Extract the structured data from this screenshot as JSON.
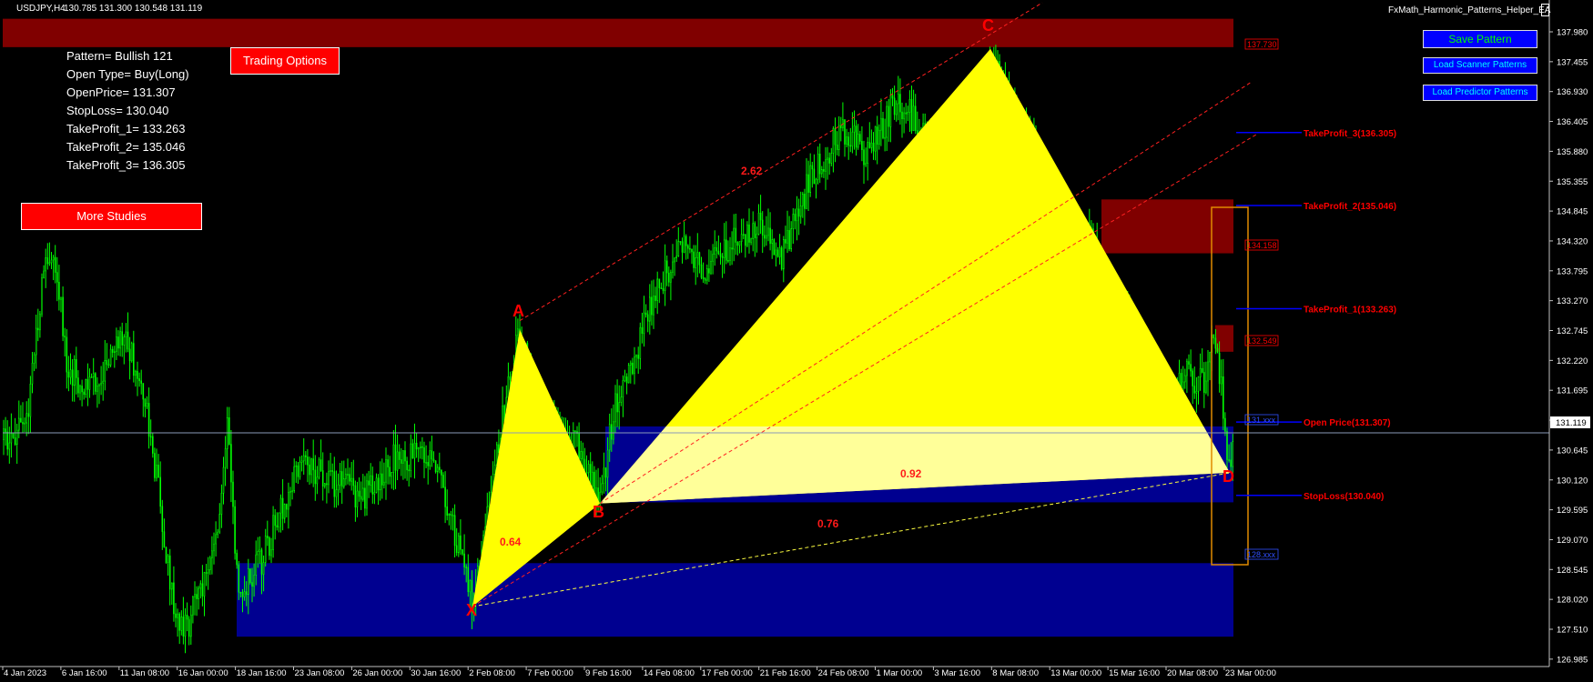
{
  "header": {
    "symbol": "USDJPY,H4",
    "ohlc": "130.785 131.300 130.548 131.119",
    "ea_name": "FxMath_Harmonic_Patterns_Helper_EA"
  },
  "info_panel": {
    "lines": [
      "Pattern= Bullish 121",
      "Open Type= Buy(Long)",
      "OpenPrice= 131.307",
      "StopLoss= 130.040",
      "TakeProfit_1= 133.263",
      "TakeProfit_2= 135.046",
      "TakeProfit_3= 136.305"
    ]
  },
  "buttons": {
    "trading_options": "Trading Options",
    "more_studies": "More Studies",
    "save_pattern": "Save Pattern",
    "load_scanner": "Load Scanner Patterns",
    "load_predictor": "Load Predictor Patterns"
  },
  "colors": {
    "background": "#000000",
    "candles": "#00ff00",
    "pattern_fill": "#ffff00",
    "pattern_fill_light": "#ffff99",
    "zone_red": "#800000",
    "zone_blue": "#000090",
    "label_red": "#ff0000",
    "level_line": "#0000ff",
    "ratio_text": "#ff1a1a",
    "bracket": "#e08a00"
  },
  "chart_data": {
    "type": "candlestick",
    "price_axis": {
      "range": [
        127.1,
        138.28
      ],
      "ticks": [
        "137.980",
        "137.455",
        "136.930",
        "136.405",
        "135.880",
        "135.355",
        "134.845",
        "134.320",
        "133.795",
        "133.270",
        "132.745",
        "132.220",
        "131.695",
        "131.170",
        "130.645",
        "130.120",
        "129.595",
        "129.070",
        "128.545",
        "128.020",
        "127.510",
        "126.985"
      ],
      "current_price": "131.119"
    },
    "time_axis": {
      "labels": [
        "4 Jan 2023",
        "6 Jan 16:00",
        "11 Jan 08:00",
        "16 Jan 00:00",
        "18 Jan 16:00",
        "23 Jan 08:00",
        "26 Jan 00:00",
        "30 Jan 16:00",
        "2 Feb 08:00",
        "7 Feb 00:00",
        "9 Feb 16:00",
        "14 Feb 08:00",
        "17 Feb 00:00",
        "21 Feb 16:00",
        "24 Feb 08:00",
        "1 Mar 00:00",
        "3 Mar 16:00",
        "8 Mar 08:00",
        "13 Mar 00:00",
        "15 Mar 16:00",
        "20 Mar 08:00",
        "23 Mar 00:00"
      ]
    },
    "pattern": {
      "points": [
        {
          "name": "X",
          "price": 128.12
        },
        {
          "name": "A",
          "price": 132.9
        },
        {
          "name": "B",
          "price": 129.9
        },
        {
          "name": "C",
          "price": 137.75
        },
        {
          "name": "D",
          "price": 130.43
        }
      ],
      "ratios": [
        "0.64",
        "2.62",
        "0.92",
        "0.76"
      ]
    },
    "zones": [
      {
        "type": "supply",
        "label": "137.730",
        "top": 138.27,
        "bottom": 137.78
      },
      {
        "type": "supply",
        "label": "134.158",
        "top": 135.15,
        "bottom": 134.22
      },
      {
        "type": "supply",
        "label": "132.549",
        "top": 132.98,
        "bottom": 132.52
      },
      {
        "type": "demand",
        "label": "131.xxx",
        "top": 131.23,
        "bottom": 129.92
      },
      {
        "type": "demand",
        "label": "128.xxx",
        "top": 128.87,
        "bottom": 127.6
      }
    ],
    "levels": [
      {
        "label": "TakeProfit_3(136.305)",
        "price": 136.305
      },
      {
        "label": "TakeProfit_2(135.046)",
        "price": 135.046
      },
      {
        "label": "TakeProfit_1(133.263)",
        "price": 133.263
      },
      {
        "label": "Open Price(131.307)",
        "price": 131.307
      },
      {
        "label": "StopLoss(130.040)",
        "price": 130.04
      }
    ]
  }
}
